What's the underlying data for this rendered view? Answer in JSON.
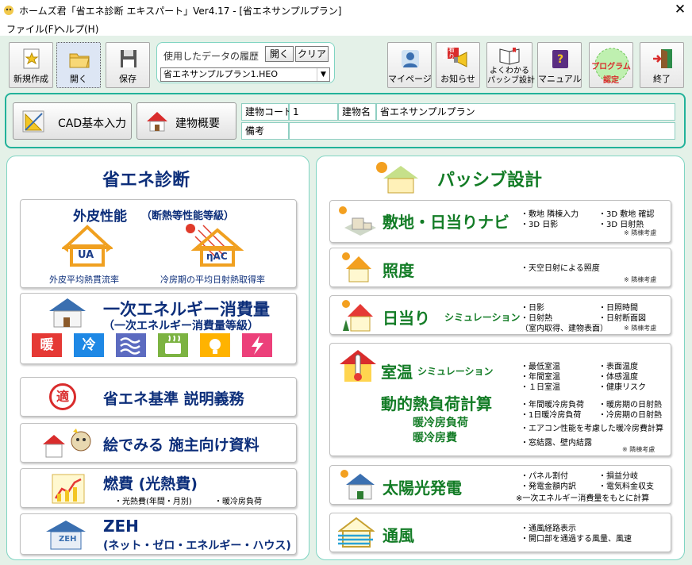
{
  "window": {
    "title": "ホームズ君「省エネ診断 エキスパート」Ver4.17 - [省エネサンプルプラン]",
    "close": "✕"
  },
  "menu": [
    "ファイル(F)",
    "ヘルプ(H)"
  ],
  "toolbar": {
    "new": "新規作成",
    "open": "開く",
    "save": "保存",
    "history_label": "使用したデータの履歴",
    "history_open": "開く",
    "history_clear": "クリア",
    "history_value": "省エネサンプルプラン1.HEO",
    "mypage": "マイページ",
    "news": "お知らせ",
    "news_badge": "新着あり",
    "faq_l1": "よくわかる",
    "faq_l2": "パッシブ設計",
    "manual": "マニュアル",
    "cert_l1": "プログラム",
    "cert_l2": "認定",
    "exit": "終了"
  },
  "info": {
    "cad": "CAD基本入力",
    "overview": "建物概要",
    "code_label": "建物コード",
    "code_value": "1",
    "name_label": "建物名",
    "name_value": "省エネサンプルプラン",
    "note_label": "備考",
    "note_value": ""
  },
  "left": {
    "heading": "省エネ診断",
    "envelope_title": "外皮性能",
    "envelope_sub": "（断熱等性能等級）",
    "ua_badge": "UA",
    "nac_badge": "ηAC",
    "ua_label": "外皮平均熱貫流率",
    "nac_label": "冷房期の平均日射熱取得率",
    "energy_title": "一次エネルギー消費量",
    "energy_sub": "（一次エネルギー消費量等級）",
    "energy_icons": [
      "暖",
      "冷",
      "換気",
      "給湯",
      "照明",
      "発電"
    ],
    "tekitekigo": "適",
    "standard": "省エネ基準 説明義務",
    "picture": "絵でみる 施主向け資料",
    "fuel_title": "燃費 (光熱費)",
    "fuel_sub1": "・光熱費(年間・月別)",
    "fuel_sub2": "・暖冷房負荷",
    "zeh_badge": "ZEH",
    "zeh_title": "ZEH",
    "zeh_sub": "(ネット・ゼロ・エネルギー・ハウス)"
  },
  "right": {
    "heading": "パッシブ設計",
    "site_title": "敷地・日当りナビ",
    "site_items": [
      "・敷地 隣棟入力",
      "・3D 敷地 確認",
      "・3D 日影",
      "・3D 日射熱"
    ],
    "site_note": "※ 隣棟考慮",
    "illum_title": "照度",
    "illum_items": [
      "・天空日射による照度"
    ],
    "illum_note": "※ 隣棟考慮",
    "sun_title": "日当り",
    "sun_suffix": "シミュレーション",
    "sun_items": [
      "・日影",
      "・日照時間",
      "・日射熱",
      "・日射断面図",
      "（室内取得、建物表面）"
    ],
    "sun_note": "※ 隣棟考慮",
    "temp_title": "室温",
    "temp_suffix": "シミュレーション",
    "temp_items": [
      "・最低室温",
      "・表面温度",
      "・年間室温",
      "・体感温度",
      "・１日室温",
      "・健康リスク"
    ],
    "load_title": "動的熱負荷計算",
    "load_sub1": "暖冷房負荷",
    "load_sub2": "暖冷房費",
    "load_items": [
      "・年間暖冷房負荷",
      "・暖房期の日射熱",
      "・1日暖冷房負荷",
      "・冷房期の日射熱",
      "・エアコン性能を考慮した暖冷房費計算",
      "・窓結露、壁内結露"
    ],
    "load_note": "※ 隣棟考慮",
    "pv_title": "太陽光発電",
    "pv_items": [
      "・パネル割付",
      "・損益分岐",
      "・発電金額内訳",
      "・電気料金収支"
    ],
    "pv_note": "※一次エネルギー消費量をもとに計算",
    "vent_title": "通風",
    "vent_items": [
      "・通風経路表示",
      "・開口部を通過する風量、風速"
    ]
  },
  "colors": {
    "accent": "#22b29a",
    "navy": "#0c2e7a",
    "green": "#137c26",
    "panel_bg": "#e4f1e8"
  }
}
